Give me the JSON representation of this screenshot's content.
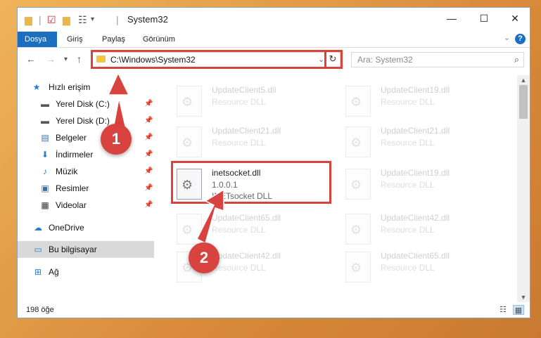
{
  "window": {
    "title": "System32",
    "controls": {
      "minimize": "—",
      "maximize": "☐",
      "close": "✕"
    }
  },
  "quick_access_toolbar": [
    "folder-icon",
    "properties-icon",
    "new-folder-icon",
    "customize-icon"
  ],
  "ribbon": {
    "tabs": [
      {
        "label": "Dosya",
        "active": true
      },
      {
        "label": "Giriş"
      },
      {
        "label": "Paylaş"
      },
      {
        "label": "Görünüm"
      }
    ],
    "help": "?"
  },
  "navigation": {
    "address": "C:\\Windows\\System32",
    "search_placeholder": "Ara: System32"
  },
  "sidebar": {
    "items": [
      {
        "label": "Hızlı erişim",
        "icon": "star-icon",
        "pinned": false
      },
      {
        "label": "Yerel Disk (C:)",
        "icon": "drive-icon",
        "pinned": true
      },
      {
        "label": "Yerel Disk (D:)",
        "icon": "drive-icon",
        "pinned": true
      },
      {
        "label": "Belgeler",
        "icon": "documents-icon",
        "pinned": true
      },
      {
        "label": "İndirmeler",
        "icon": "download-icon",
        "pinned": true
      },
      {
        "label": "Müzik",
        "icon": "music-icon",
        "pinned": true
      },
      {
        "label": "Resimler",
        "icon": "pictures-icon",
        "pinned": true
      },
      {
        "label": "Videolar",
        "icon": "videos-icon",
        "pinned": true
      },
      {
        "label": "OneDrive",
        "icon": "cloud-icon",
        "pinned": false
      },
      {
        "label": "Bu bilgisayar",
        "icon": "computer-icon",
        "pinned": false,
        "selected": true
      },
      {
        "label": "Ağ",
        "icon": "network-icon",
        "pinned": false
      }
    ]
  },
  "files": [
    {
      "name": "UpdateClient5.dll",
      "line2": "Resource DLL",
      "faded": true
    },
    {
      "name": "UpdateClient19.dll",
      "line2": "Resource DLL",
      "faded": true
    },
    {
      "name": "UpdateClient21.dll",
      "line2": "Resource DLL",
      "faded": true
    },
    {
      "name": "UpdateClient21.dll",
      "line2": "Resource DLL",
      "faded": true
    },
    {
      "name": "inetsocket.dll",
      "version": "1.0.0.1",
      "line2": "INETsocket DLL",
      "faded": false
    },
    {
      "name": "UpdateClient19.dll",
      "line2": "Resource DLL",
      "faded": true
    },
    {
      "name": "UpdateClient65.dll",
      "line2": "Resource DLL",
      "faded": true
    },
    {
      "name": "UpdateClient42.dll",
      "line2": "Resource DLL",
      "faded": true
    },
    {
      "name": "UpdateClient42.dll",
      "line2": "Resource DLL",
      "faded": true
    },
    {
      "name": "UpdateClient65.dll",
      "line2": "Resource DLL",
      "faded": true
    }
  ],
  "status": {
    "item_count": "198 öğe"
  },
  "annotations": [
    {
      "label": "1",
      "color": "#d9433f"
    },
    {
      "label": "2",
      "color": "#d9433f"
    }
  ],
  "colors": {
    "accent": "#1a6fc0",
    "highlight": "#d9433f",
    "selected_row": "#d9d9d9"
  }
}
